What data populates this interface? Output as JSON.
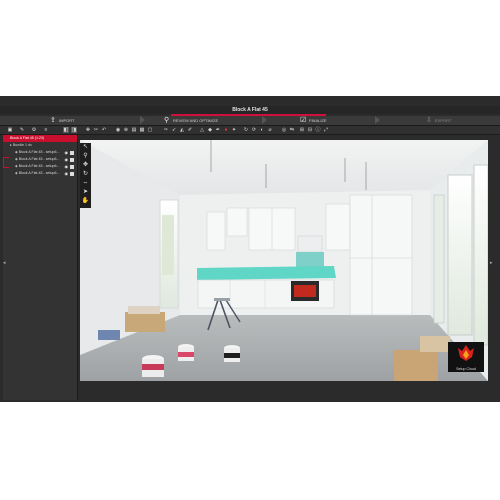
{
  "window": {
    "app_name": "CapturaReview360 3D",
    "minimize": "–",
    "maximize": "☐",
    "close": "✕"
  },
  "project": {
    "title": "Block A Flat 45"
  },
  "workflow_steps": [
    {
      "label": "IMPORT",
      "icon": "import-icon",
      "glyph": "⇪"
    },
    {
      "label": "REVIEW AND OPTIMIZE",
      "icon": "review-icon",
      "glyph": "⚲"
    },
    {
      "label": "FINALIZE",
      "icon": "finalize-icon",
      "glyph": "☑"
    },
    {
      "label": "EXPORT",
      "icon": "export-icon",
      "glyph": "⇩"
    }
  ],
  "tree": [
    {
      "label": "Block A Flat 45 (1:23)",
      "selected": true
    },
    {
      "label": "Bundle 1 dx",
      "selected": false
    },
    {
      "label": "Block A Flat 45 - setup6...",
      "selected": false
    },
    {
      "label": "Block A Flat 45 - setup6...",
      "selected": false
    },
    {
      "label": "Block A Flat 45 - setup6...",
      "selected": false
    },
    {
      "label": "Block A Flat 45 - setup6...",
      "selected": false
    }
  ],
  "splash": {
    "caption": "Setup Cloud"
  },
  "colors": {
    "accent": "#c8102e",
    "dark_bg": "#2b2b2b",
    "panel_bg": "#333333",
    "worktop": "#5fd6c6"
  }
}
